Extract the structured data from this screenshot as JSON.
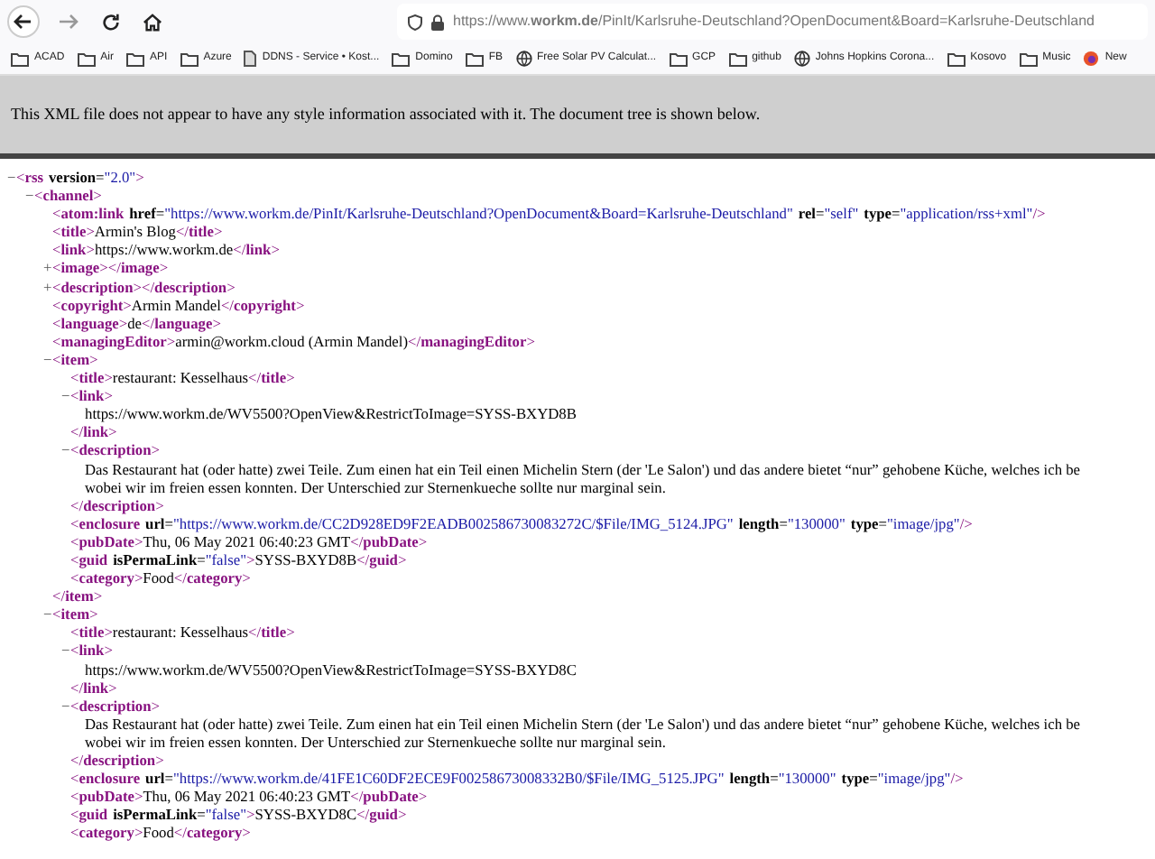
{
  "browser": {
    "url": "https://www.**workm.de**/PinIt/Karlsruhe-Deutschland?OpenDocument&Board=Karlsruhe-Deutschland",
    "bookmarks": [
      {
        "kind": "folder",
        "label": "ACAD"
      },
      {
        "kind": "folder",
        "label": "Air"
      },
      {
        "kind": "folder",
        "label": "API"
      },
      {
        "kind": "folder",
        "label": "Azure"
      },
      {
        "kind": "page",
        "label": "DDNS - Service • Kost..."
      },
      {
        "kind": "folder",
        "label": "Domino"
      },
      {
        "kind": "folder",
        "label": "FB"
      },
      {
        "kind": "globe",
        "label": "Free Solar PV Calculat..."
      },
      {
        "kind": "folder",
        "label": "GCP"
      },
      {
        "kind": "folder",
        "label": "github"
      },
      {
        "kind": "globe",
        "label": "Johns Hopkins Corona..."
      },
      {
        "kind": "folder",
        "label": "Kosovo"
      },
      {
        "kind": "folder",
        "label": "Music"
      },
      {
        "kind": "site",
        "label": "New"
      }
    ]
  },
  "info_bar": {
    "message": "This XML file does not appear to have any style information associated with it. The document tree is shown below."
  },
  "xml_tree": [
    {
      "kind": "open",
      "toggle": "−",
      "open": "<**rss**",
      "attrs": [
        {
          "name": "**version**=",
          "value": "\"2.0\""
        }
      ],
      "end": ">",
      "children": [
        {
          "kind": "open",
          "toggle": "−",
          "open": "<**channel**>",
          "children": [
            {
              "kind": "empty",
              "open": "<**atom:link**",
              "attrs": [
                {
                  "name": "**href**=",
                  "value": "\"https://www.workm.de/PinIt/Karlsruhe-Deutschland?OpenDocument&Board=Karlsruhe-Deutschland\""
                },
                {
                  "name": "**rel**=",
                  "value": "\"self\""
                },
                {
                  "name": "**type**=",
                  "value": "\"application/rss+xml\""
                }
              ],
              "end": "/>"
            },
            {
              "kind": "inline",
              "open": "<**title**>",
              "text": "Armin's Blog",
              "close": "</**title**>"
            },
            {
              "kind": "inline",
              "open": "<**link**>",
              "text": "https://www.workm.de",
              "close": "</**link**>"
            },
            {
              "kind": "collapsed",
              "toggle": "+",
              "open": "<**image**>",
              "close": "</**image**>"
            },
            {
              "kind": "collapsed",
              "toggle": "+",
              "open": "<**description**>",
              "close": "</**description**>"
            },
            {
              "kind": "inline",
              "open": "<**copyright**>",
              "text": "Armin Mandel",
              "close": "</**copyright**>"
            },
            {
              "kind": "inline",
              "open": "<**language**>",
              "text": "de",
              "close": "</**language**>"
            },
            {
              "kind": "inline",
              "open": "<**managingEditor**>",
              "text": "armin@workm.cloud (Armin Mandel)",
              "close": "</**managingEditor**>"
            },
            {
              "kind": "open",
              "toggle": "−",
              "open": "<**item**>",
              "close": "</**item**>",
              "children": [
                {
                  "kind": "inline",
                  "open": "<**title**>",
                  "text": "restaurant: Kesselhaus",
                  "close": "</**title**>"
                },
                {
                  "kind": "open",
                  "toggle": "−",
                  "open": "<**link**>",
                  "close": "</**link**>",
                  "children": [
                    {
                      "kind": "text",
                      "lines": [
                        "https://www.workm.de/WV5500?OpenView&RestrictToImage=SYSS-BXYD8B"
                      ]
                    }
                  ]
                },
                {
                  "kind": "open",
                  "toggle": "−",
                  "open": "<**description**>",
                  "close": "</**description**>",
                  "children": [
                    {
                      "kind": "text",
                      "lines": [
                        "Das Restaurant hat (oder hatte) zwei Teile. Zum einen hat ein Teil einen Michelin Stern (der 'Le Salon') und das andere bietet “nur” gehobene Küche, welches ich be",
                        "wobei wir im freien essen konnten. Der Unterschied zur Sternenkueche sollte nur marginal sein."
                      ]
                    }
                  ]
                },
                {
                  "kind": "empty",
                  "open": "<**enclosure**",
                  "attrs": [
                    {
                      "name": "**url**=",
                      "value": "\"https://www.workm.de/CC2D928ED9F2EADB002586730083272C/$File/IMG_5124.JPG\""
                    },
                    {
                      "name": "**length**=",
                      "value": "\"130000\""
                    },
                    {
                      "name": "**type**=",
                      "value": "\"image/jpg\""
                    }
                  ],
                  "end": "/>"
                },
                {
                  "kind": "inline",
                  "open": "<**pubDate**>",
                  "text": "Thu, 06 May 2021 06:40:23 GMT",
                  "close": "</**pubDate**>"
                },
                {
                  "kind": "inline",
                  "open": "<**guid**",
                  "attrs": [
                    {
                      "name": "**isPermaLink**=",
                      "value": "\"false\""
                    }
                  ],
                  "end": ">",
                  "text": "SYSS-BXYD8B",
                  "close": "</**guid**>"
                },
                {
                  "kind": "inline",
                  "open": "<**category**>",
                  "text": "Food",
                  "close": "</**category**>"
                }
              ]
            },
            {
              "kind": "open",
              "toggle": "−",
              "open": "<**item**>",
              "children": [
                {
                  "kind": "inline",
                  "open": "<**title**>",
                  "text": "restaurant: Kesselhaus",
                  "close": "</**title**>"
                },
                {
                  "kind": "open",
                  "toggle": "−",
                  "open": "<**link**>",
                  "close": "</**link**>",
                  "children": [
                    {
                      "kind": "text",
                      "lines": [
                        "https://www.workm.de/WV5500?OpenView&RestrictToImage=SYSS-BXYD8C"
                      ]
                    }
                  ]
                },
                {
                  "kind": "open",
                  "toggle": "−",
                  "open": "<**description**>",
                  "close": "</**description**>",
                  "children": [
                    {
                      "kind": "text",
                      "lines": [
                        "Das Restaurant hat (oder hatte) zwei Teile. Zum einen hat ein Teil einen Michelin Stern (der 'Le Salon') und das andere bietet “nur” gehobene Küche, welches ich be",
                        "wobei wir im freien essen konnten. Der Unterschied zur Sternenkueche sollte nur marginal sein."
                      ]
                    }
                  ]
                },
                {
                  "kind": "empty",
                  "open": "<**enclosure**",
                  "attrs": [
                    {
                      "name": "**url**=",
                      "value": "\"https://www.workm.de/41FE1C60DF2ECE9F00258673008332B0/$File/IMG_5125.JPG\""
                    },
                    {
                      "name": "**length**=",
                      "value": "\"130000\""
                    },
                    {
                      "name": "**type**=",
                      "value": "\"image/jpg\""
                    }
                  ],
                  "end": "/>"
                },
                {
                  "kind": "inline",
                  "open": "<**pubDate**>",
                  "text": "Thu, 06 May 2021 06:40:23 GMT",
                  "close": "</**pubDate**>"
                },
                {
                  "kind": "inline",
                  "open": "<**guid**",
                  "attrs": [
                    {
                      "name": "**isPermaLink**=",
                      "value": "\"false\""
                    }
                  ],
                  "end": ">",
                  "text": "SYSS-BXYD8C",
                  "close": "</**guid**>"
                },
                {
                  "kind": "inline",
                  "open": "<**category**>",
                  "text": "Food",
                  "close": "</**category**>"
                }
              ]
            }
          ]
        }
      ]
    }
  ]
}
